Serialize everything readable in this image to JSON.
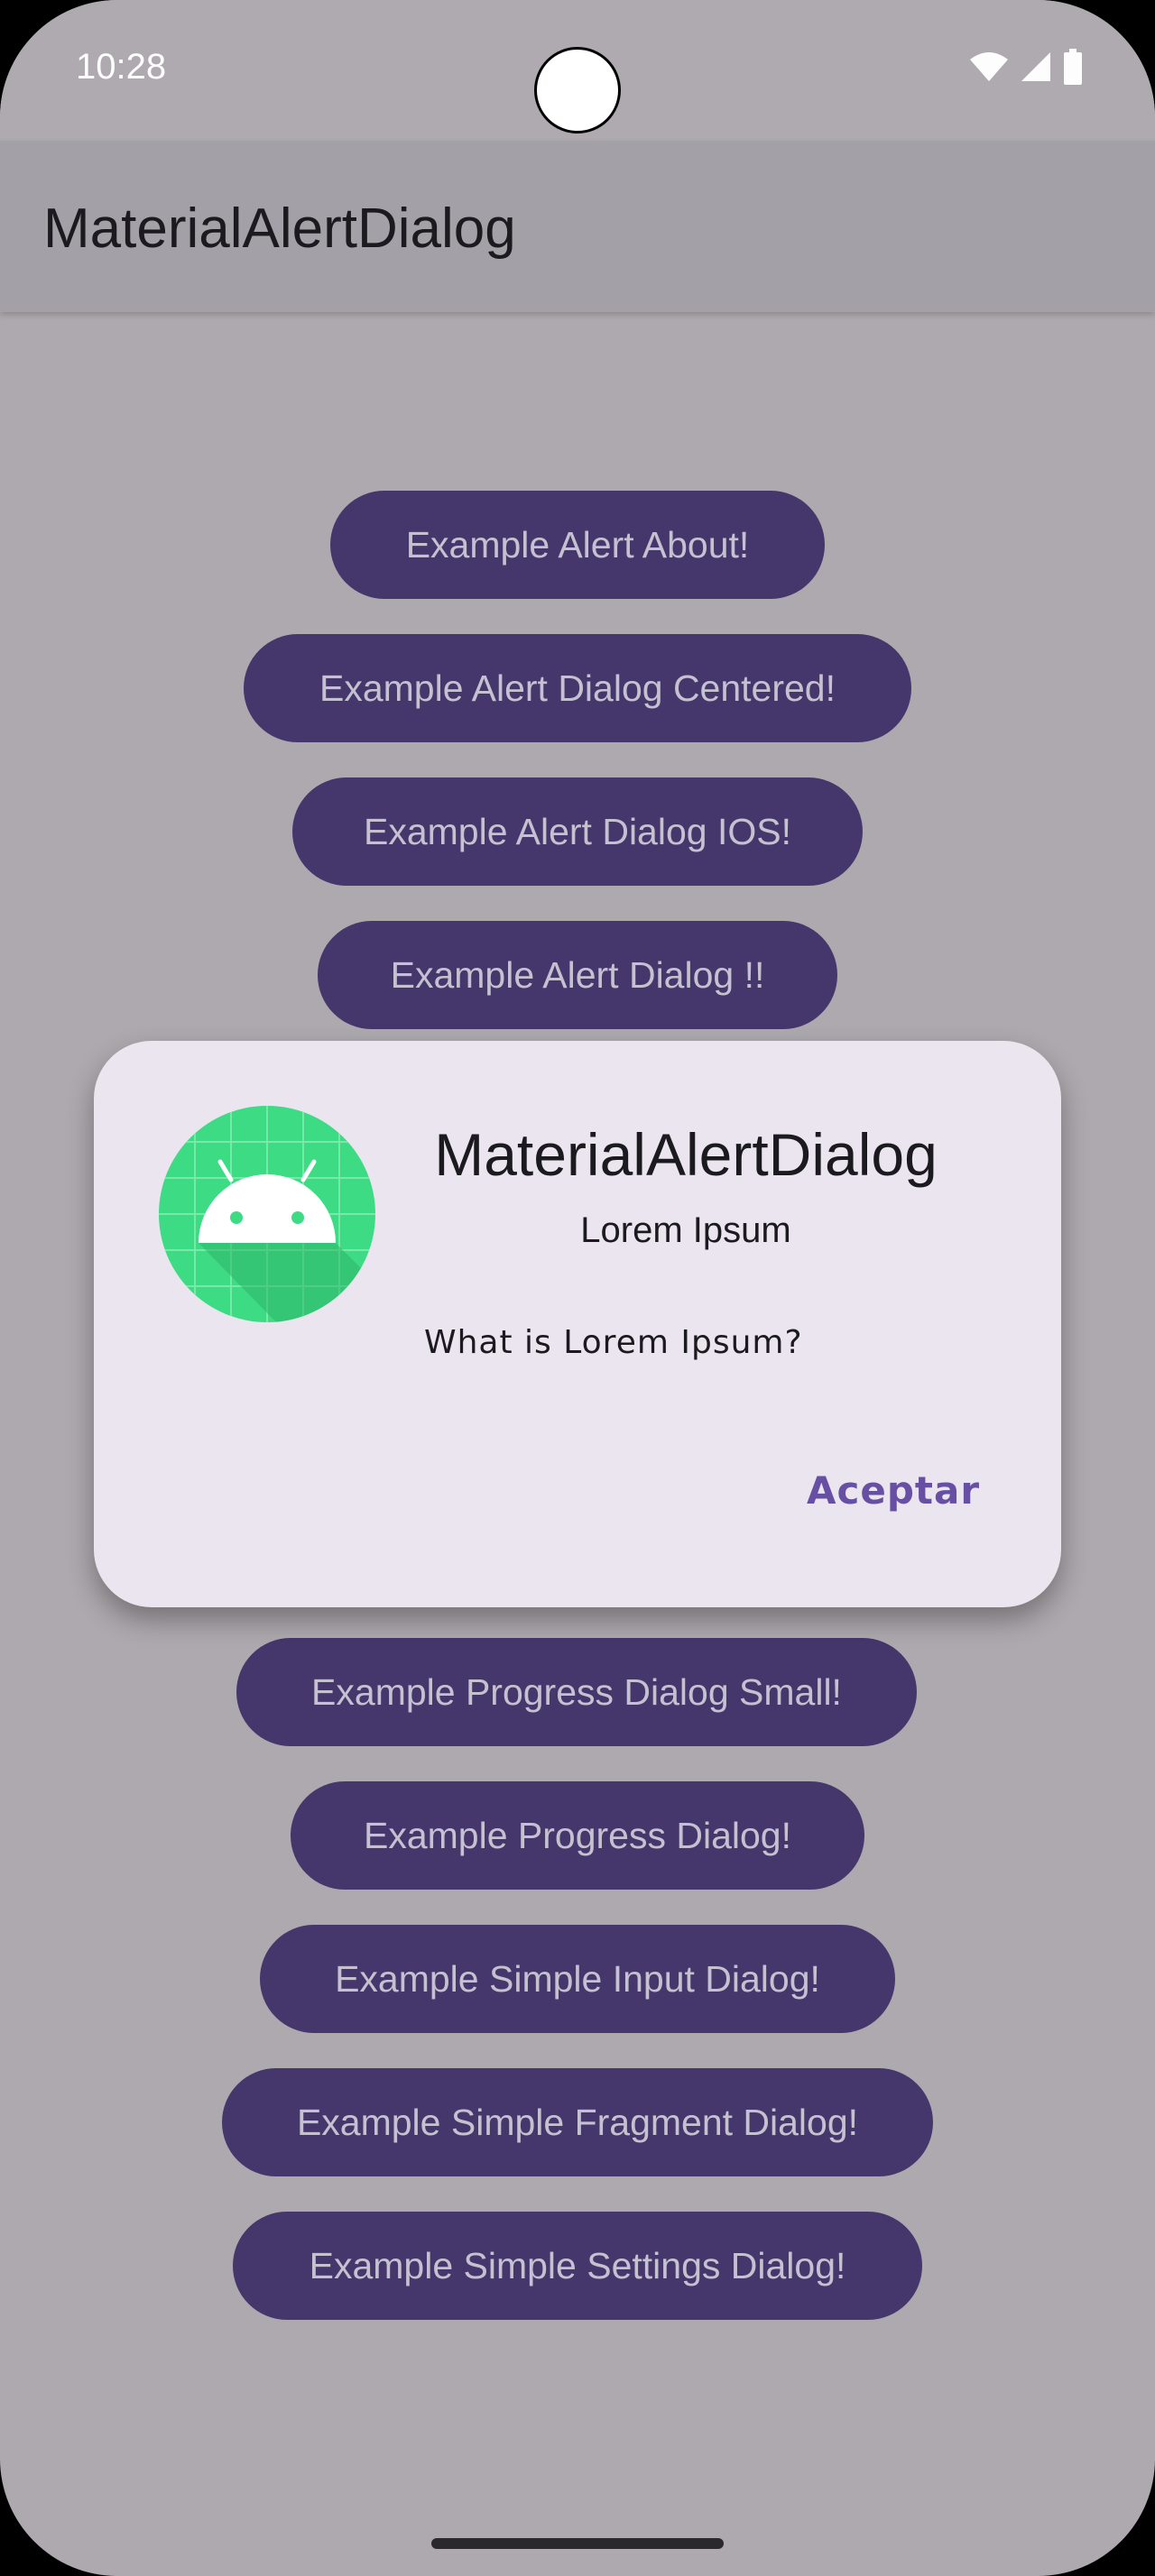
{
  "status_bar": {
    "time": "10:28",
    "icons": [
      "wifi-icon",
      "signal-icon",
      "battery-icon"
    ]
  },
  "app_bar": {
    "title": "MaterialAlertDialog"
  },
  "buttons": {
    "about": "Example Alert About!",
    "centered": "Example Alert Dialog Centered!",
    "ios": "Example Alert Dialog IOS!",
    "plain": "Example Alert Dialog !!",
    "progress_small": "Example Progress Dialog Small!",
    "progress": "Example Progress Dialog!",
    "simple_input": "Example Simple Input Dialog!",
    "simple_fragment": "Example Simple Fragment Dialog!",
    "simple_settings": "Example Simple Settings Dialog!"
  },
  "dialog": {
    "icon": "android-icon",
    "title": "MaterialAlertDialog",
    "subtitle": "Lorem Ipsum",
    "message": "What is Lorem Ipsum?",
    "action_label": "Aceptar"
  },
  "colors": {
    "button_background": "#45366c",
    "button_text": "#c6c1d0",
    "dialog_background": "#ebe5ef",
    "accent": "#6750a4",
    "scrim_background": "#ada9ae"
  }
}
